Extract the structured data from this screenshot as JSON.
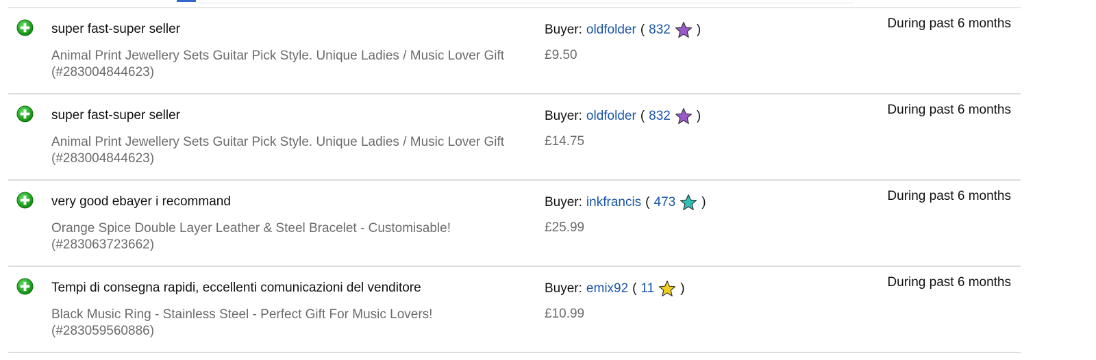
{
  "feedback": [
    {
      "comment": "super fast-super seller",
      "item": "Animal Print Jewellery Sets Guitar Pick Style. Unique Ladies / Music Lover Gift (#283004844623)",
      "buyer_label": "Buyer:",
      "buyer_name": "oldfolder",
      "buyer_score": "832",
      "star_color": "#9b59c9",
      "price": "£9.50",
      "period": "During past 6 months"
    },
    {
      "comment": "super fast-super seller",
      "item": "Animal Print Jewellery Sets Guitar Pick Style. Unique Ladies / Music Lover Gift (#283004844623)",
      "buyer_label": "Buyer:",
      "buyer_name": "oldfolder",
      "buyer_score": "832",
      "star_color": "#9b59c9",
      "price": "£14.75",
      "period": "During past 6 months"
    },
    {
      "comment": "very good ebayer i recommand",
      "item": "Orange Spice Double Layer Leather & Steel Bracelet - Customisable! (#283063723662)",
      "buyer_label": "Buyer:",
      "buyer_name": "inkfrancis",
      "buyer_score": "473",
      "star_color": "#2fc0b8",
      "price": "£25.99",
      "period": "During past 6 months"
    },
    {
      "comment": "Tempi di consegna rapidi, eccellenti comunicazioni del venditore",
      "item": "Black Music Ring - Stainless Steel - Perfect Gift For Music Lovers! (#283059560886)",
      "buyer_label": "Buyer:",
      "buyer_name": "emix92",
      "buyer_score": "11",
      "star_color": "#f2cf1d",
      "price": "£10.99",
      "period": "During past 6 months"
    }
  ],
  "icons": {
    "rating": "plus-circle-icon",
    "buyer_rating": "star-icon"
  },
  "colors": {
    "positive_green": "#1aa31a",
    "link_blue": "#1a55a8",
    "muted_text": "#6b6b6b"
  }
}
